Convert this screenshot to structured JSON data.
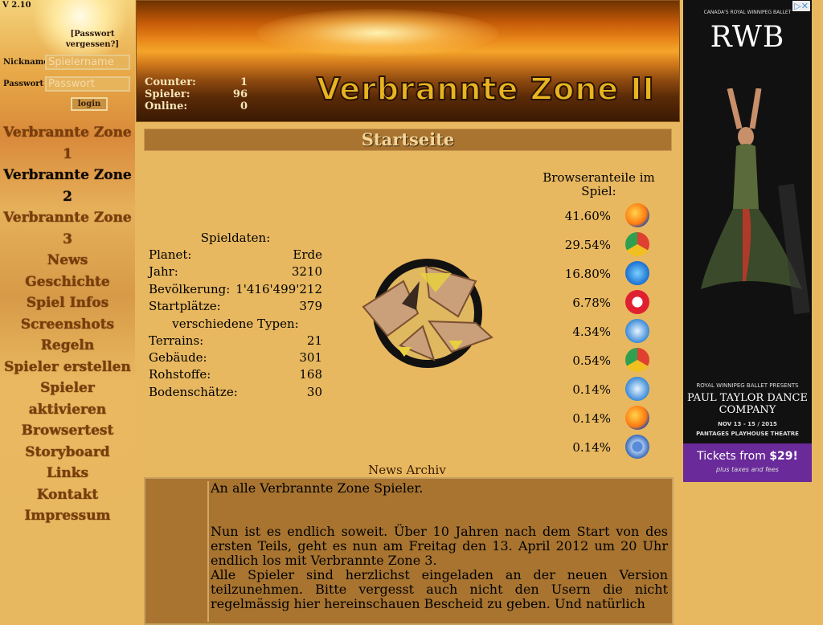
{
  "sidebar": {
    "version": "V 2.10",
    "forgot_password": "[Passwort vergessen?]",
    "nickname_label": "Nickname",
    "nickname_placeholder": "Spielername",
    "password_label": "Passwort",
    "password_placeholder": "Passwort",
    "login_label": "login",
    "nav": [
      {
        "label": "Verbrannte Zone 1",
        "active": false
      },
      {
        "label": "Verbrannte Zone 2",
        "active": true
      },
      {
        "label": "Verbrannte Zone 3",
        "active": false
      },
      {
        "label": "News",
        "active": false
      },
      {
        "label": "Geschichte",
        "active": false
      },
      {
        "label": "Spiel Infos",
        "active": false
      },
      {
        "label": "Screenshots",
        "active": false
      },
      {
        "label": "Regeln",
        "active": false
      },
      {
        "label": "Spieler erstellen",
        "active": false
      },
      {
        "label": "Spieler aktivieren",
        "active": false
      },
      {
        "label": "Browsertest",
        "active": false
      },
      {
        "label": "Storyboard",
        "active": false
      },
      {
        "label": "Links",
        "active": false
      },
      {
        "label": "Kontakt",
        "active": false
      },
      {
        "label": "Impressum",
        "active": false
      }
    ]
  },
  "header": {
    "title": "Verbrannte Zone II",
    "stats": [
      {
        "label": "Counter:",
        "value": "1"
      },
      {
        "label": "Spieler:",
        "value": "96"
      },
      {
        "label": "Online:",
        "value": "0"
      }
    ]
  },
  "main": {
    "page_title": "Startseite",
    "spieldaten": {
      "heading": "Spieldaten:",
      "rows": [
        {
          "label": "Planet:",
          "value": "Erde"
        },
        {
          "label": "Jahr:",
          "value": "3210"
        },
        {
          "label": "Bevölkerung:",
          "value": "1'416'499'212"
        },
        {
          "label": "Startplätze:",
          "value": "379"
        }
      ],
      "types_heading": "verschiedene Typen:",
      "types": [
        {
          "label": "Terrains:",
          "value": "21"
        },
        {
          "label": "Gebäude:",
          "value": "301"
        },
        {
          "label": "Rohstoffe:",
          "value": "168"
        },
        {
          "label": "Bodenschätze:",
          "value": "30"
        }
      ]
    },
    "browser_share": {
      "heading": "Browseranteile im Spiel:",
      "rows": [
        {
          "pct": "41.60%",
          "icon": "firefox-icon"
        },
        {
          "pct": "29.54%",
          "icon": "chrome-icon"
        },
        {
          "pct": "16.80%",
          "icon": "internet-explorer-icon"
        },
        {
          "pct": "6.78%",
          "icon": "opera-icon"
        },
        {
          "pct": "4.34%",
          "icon": "safari-icon"
        },
        {
          "pct": "0.54%",
          "icon": "chrome-icon"
        },
        {
          "pct": "0.14%",
          "icon": "safari-icon"
        },
        {
          "pct": "0.14%",
          "icon": "firefox-icon"
        },
        {
          "pct": "0.14%",
          "icon": "chromium-icon"
        }
      ]
    },
    "news": {
      "heading": "News Archiv",
      "paragraphs": [
        "An alle Verbrannte Zone Spieler.",
        "Nun ist es endlich soweit. Über 10 Jahren nach dem Start von des ersten Teils, geht es nun am Freitag den 13. April 2012 um 20 Uhr endlich los mit Verbrannte Zone 3.",
        "Alle Spieler sind herzlichst eingeladen an der neuen Version teilzunehmen. Bitte vergesst auch nicht den Usern die nicht regelmässig hier hereinschauen Bescheid zu geben. Und natürlich"
      ]
    }
  },
  "ad": {
    "org": "CANADA'S ROYAL WINNIPEG BALLET",
    "brand": "RWB",
    "presents": "ROYAL WINNIPEG BALLET PRESENTS",
    "company": "PAUL TAYLOR DANCE COMPANY",
    "dates": "NOV 13 - 15 / 2015",
    "venue": "PANTAGES PLAYHOUSE THEATRE",
    "cta_prefix": "Tickets from ",
    "cta_price": "$29!",
    "cta_note": "plus taxes and fees"
  },
  "colors": {
    "page_bg": "#e8b860",
    "title_bar": "#a87430",
    "nav_link": "#7a3d0a",
    "nav_active": "#0d0804",
    "header_title": "#e8b420",
    "ad_cta": "#6a2a9a"
  }
}
